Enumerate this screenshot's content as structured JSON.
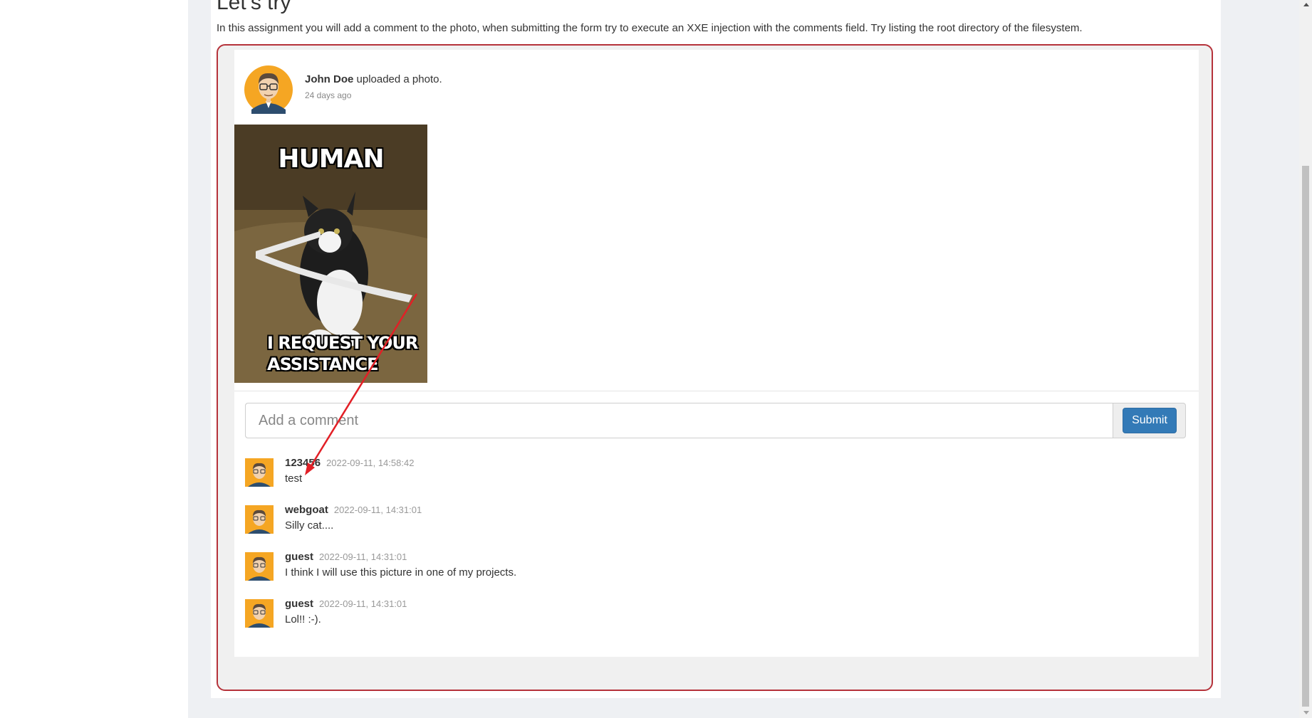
{
  "page": {
    "heading": "Let’s try",
    "instructions": "In this assignment you will add a comment to the photo, when submitting the form try to execute an XXE injection with the comments field. Try listing the root directory of the filesystem."
  },
  "post": {
    "author": "John Doe",
    "action": "uploaded a photo.",
    "time": "24 days ago",
    "photo": {
      "top_text": "HUMAN",
      "bottom_line1": "I REQUEST YOUR",
      "bottom_line2": "ASSISTANCE"
    }
  },
  "comment_form": {
    "placeholder": "Add a comment",
    "value": "",
    "submit_label": "Submit"
  },
  "comments": [
    {
      "user": "123456",
      "time": "2022-09-11, 14:58:42",
      "text": "test"
    },
    {
      "user": "webgoat",
      "time": "2022-09-11, 14:31:01",
      "text": "Silly cat...."
    },
    {
      "user": "guest",
      "time": "2022-09-11, 14:31:01",
      "text": "I think I will use this picture in one of my projects."
    },
    {
      "user": "guest",
      "time": "2022-09-11, 14:31:01",
      "text": "Lol!! :-)."
    }
  ],
  "colors": {
    "submit": "#337ab7",
    "assignment_border": "#b5323a",
    "annotation_arrow": "#e21f26",
    "avatar_bg": "#f5a623"
  },
  "icons": {
    "avatar": "avatar-icon"
  }
}
